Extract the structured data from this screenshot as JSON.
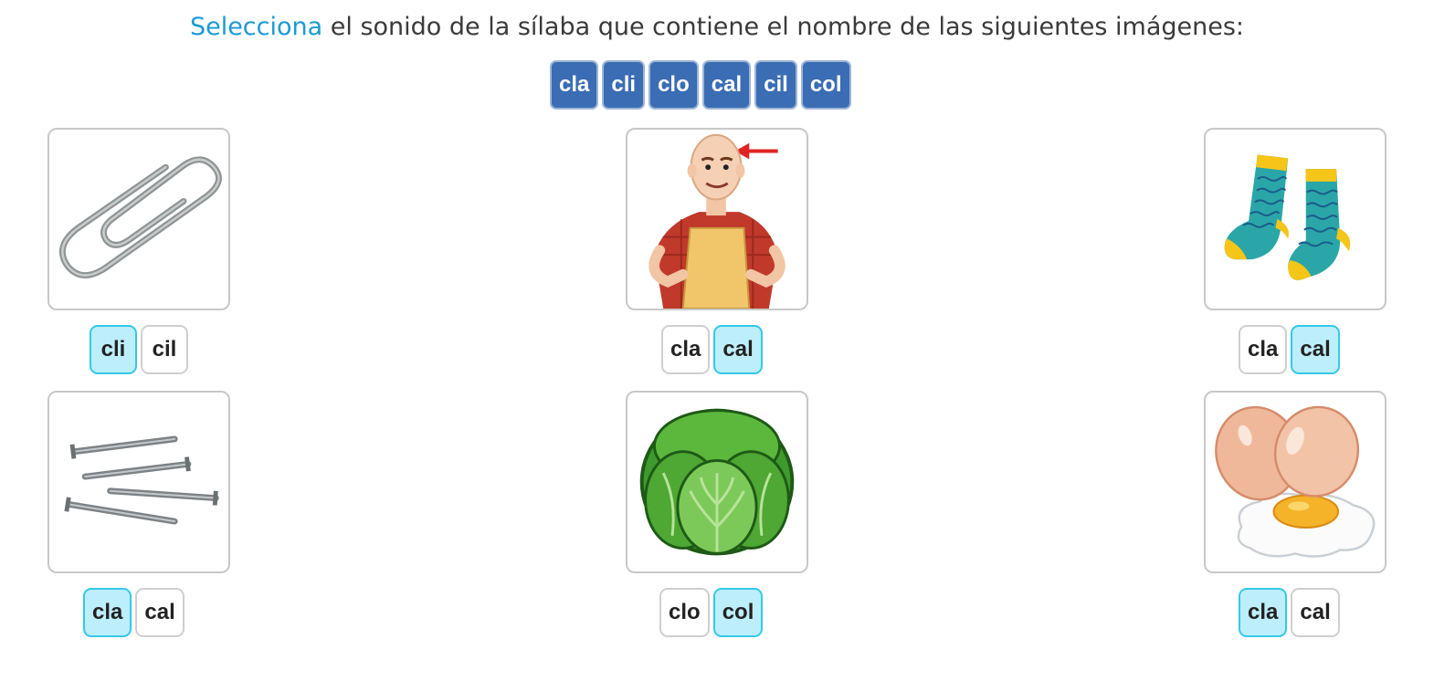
{
  "instruction": {
    "highlight": "Selecciona",
    "rest": " el sonido de la sílaba que contiene el nombre de las siguientes imágenes:"
  },
  "syllable_bank": [
    "cla",
    "cli",
    "clo",
    "cal",
    "cil",
    "col"
  ],
  "colors": {
    "accent": "#1a9ad6",
    "bank_chip": "#3a6db3",
    "selected_fill": "#bdeefb",
    "selected_border": "#35c8ea"
  },
  "cards": [
    {
      "image": "paperclip-image",
      "options": [
        "cli",
        "cil"
      ],
      "selected": 0
    },
    {
      "image": "bald-man-image",
      "options": [
        "cla",
        "cal"
      ],
      "selected": 1
    },
    {
      "image": "socks-image",
      "options": [
        "cla",
        "cal"
      ],
      "selected": 1
    },
    {
      "image": "nails-image",
      "options": [
        "cla",
        "cal"
      ],
      "selected": 0
    },
    {
      "image": "cabbage-image",
      "options": [
        "clo",
        "col"
      ],
      "selected": 1
    },
    {
      "image": "eggs-image",
      "options": [
        "cla",
        "cal"
      ],
      "selected": 0
    }
  ]
}
